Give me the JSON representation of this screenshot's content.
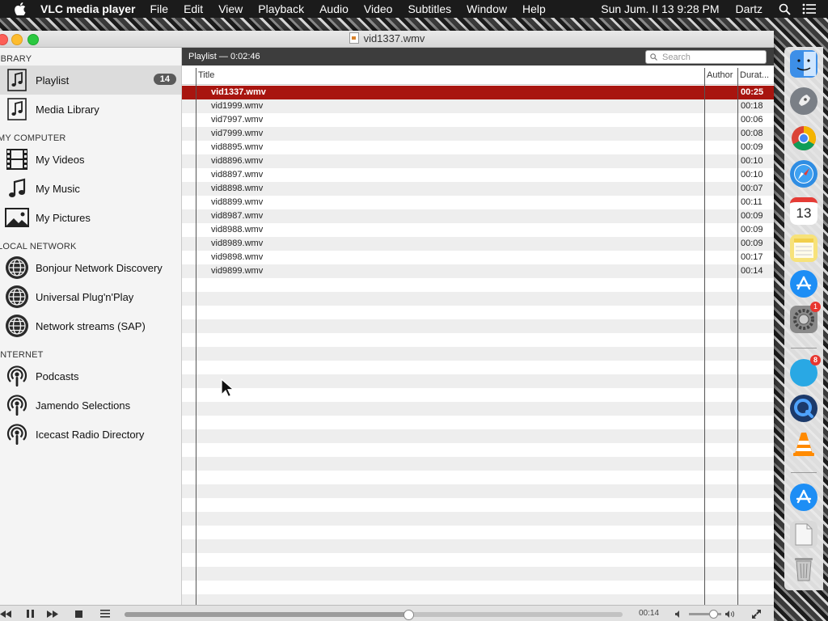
{
  "menubar": {
    "app_name": "VLC media player",
    "menus": [
      "File",
      "Edit",
      "View",
      "Playback",
      "Audio",
      "Video",
      "Subtitles",
      "Window",
      "Help"
    ],
    "clock": "Sun Jum. II 13  9:28 PM",
    "user": "Dartz"
  },
  "window": {
    "title": "vid1337.wmv"
  },
  "sidebar": {
    "sections": [
      {
        "label": "LIBRARY"
      },
      {
        "label": "MY COMPUTER"
      },
      {
        "label": "LOCAL NETWORK"
      },
      {
        "label": "INTERNET"
      }
    ],
    "items": [
      {
        "label": "Playlist",
        "icon": "music-note-icon",
        "badge": "14"
      },
      {
        "label": "Media Library",
        "icon": "music-library-icon"
      },
      {
        "label": "My Videos",
        "icon": "film-icon"
      },
      {
        "label": "My Music",
        "icon": "music-note-icon"
      },
      {
        "label": "My Pictures",
        "icon": "picture-icon"
      },
      {
        "label": "Bonjour Network Discovery",
        "icon": "globe-icon"
      },
      {
        "label": "Universal Plug'n'Play",
        "icon": "globe-icon"
      },
      {
        "label": "Network streams (SAP)",
        "icon": "globe-icon"
      },
      {
        "label": "Podcasts",
        "icon": "podcast-icon"
      },
      {
        "label": "Jamendo Selections",
        "icon": "podcast-icon"
      },
      {
        "label": "Icecast Radio Directory",
        "icon": "podcast-icon"
      }
    ]
  },
  "playlist": {
    "header_title": "Playlist — 0:02:46",
    "search_placeholder": "Search",
    "columns": {
      "title": "Title",
      "author": "Author",
      "duration": "Durat..."
    },
    "rows": [
      {
        "title": "vid1337.wmv",
        "duration": "00:25",
        "current": true
      },
      {
        "title": "vid1999.wmv",
        "duration": "00:18"
      },
      {
        "title": "vid7997.wmv",
        "duration": "00:06"
      },
      {
        "title": "vid7999.wmv",
        "duration": "00:08"
      },
      {
        "title": "vid8895.wmv",
        "duration": "00:09"
      },
      {
        "title": "vid8896.wmv",
        "duration": "00:10"
      },
      {
        "title": "vid8897.wmv",
        "duration": "00:10"
      },
      {
        "title": "vid8898.wmv",
        "duration": "00:07"
      },
      {
        "title": "vid8899.wmv",
        "duration": "00:11"
      },
      {
        "title": "vid8987.wmv",
        "duration": "00:09"
      },
      {
        "title": "vid8988.wmv",
        "duration": "00:09"
      },
      {
        "title": "vid8989.wmv",
        "duration": "00:09"
      },
      {
        "title": "vid9898.wmv",
        "duration": "00:17"
      },
      {
        "title": "vid9899.wmv",
        "duration": "00:14"
      }
    ]
  },
  "controls": {
    "elapsed": "00:14",
    "seek_fraction": 0.57,
    "volume_fraction": 0.75
  },
  "dock": {
    "apps": [
      {
        "name": "finder-icon",
        "color": "#3d8fe8"
      },
      {
        "name": "launchpad-icon",
        "color": "#7a7f86"
      },
      {
        "name": "chrome-icon",
        "color": "#e8e8e8"
      },
      {
        "name": "safari-icon",
        "color": "#2f8de3"
      },
      {
        "name": "calendar-icon",
        "color": "#ffffff",
        "text": "13"
      },
      {
        "name": "notes-icon",
        "color": "#f7e27a"
      },
      {
        "name": "app-store-icon",
        "color": "#1d8ef5"
      },
      {
        "name": "system-preferences-icon",
        "color": "#8a8a8a",
        "badge": "1"
      },
      {
        "name": "mk-app-icon",
        "color": "#29a8e4",
        "badge": "8"
      },
      {
        "name": "quicktime-icon",
        "color": "#1c3a6b"
      },
      {
        "name": "vlc-icon",
        "color": "#ff8a00"
      },
      {
        "name": "app-store-icon",
        "color": "#1d8ef5"
      },
      {
        "name": "documents-icon",
        "color": "#d9d9d9"
      },
      {
        "name": "trash-icon",
        "color": "#b5b5b5"
      }
    ]
  },
  "colors": {
    "selected_row": "#a8150f",
    "pane_header": "#3d3d3d"
  }
}
